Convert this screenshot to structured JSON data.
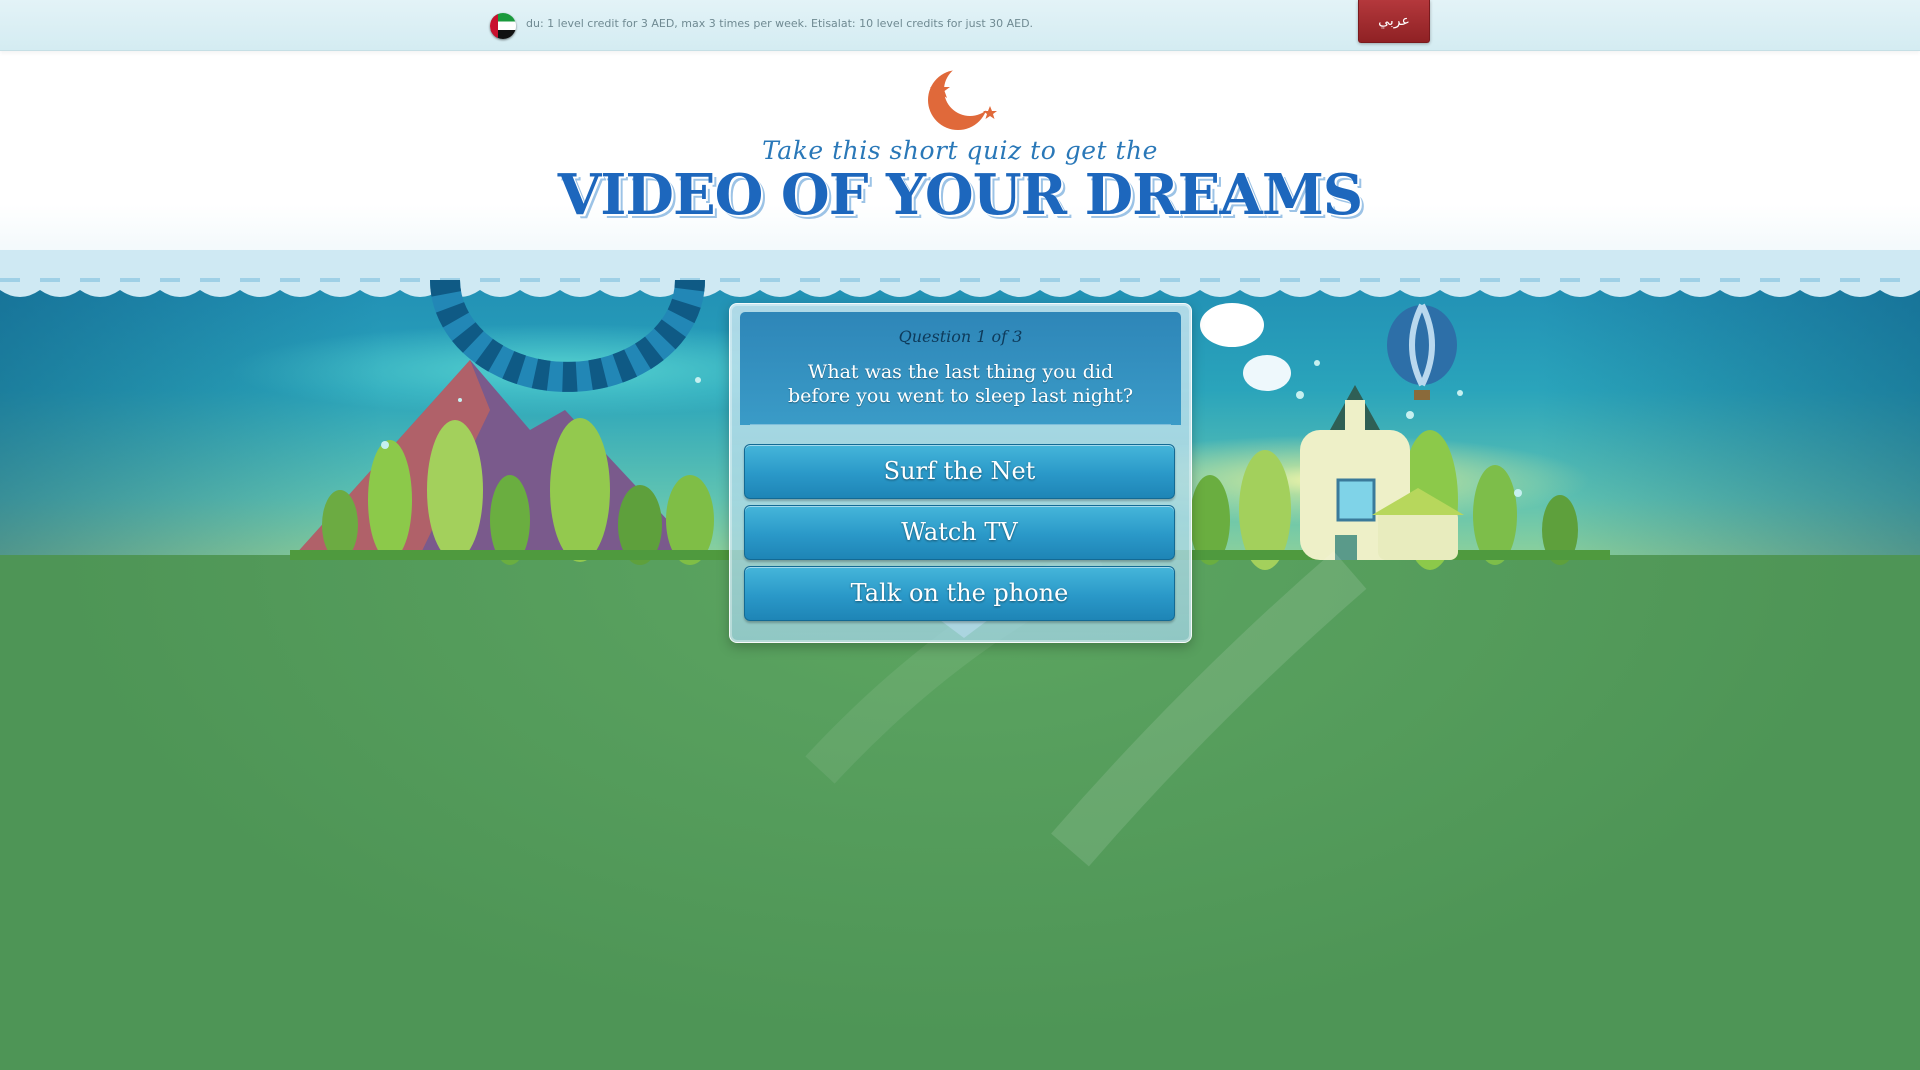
{
  "topbar": {
    "flag_icon": "uae-flag-icon",
    "pricing_text": "du: 1 level credit for 3 AED, max 3 times per week. Etisalat: 10 level credits for just 30 AED.",
    "language_button": "عربي"
  },
  "header": {
    "logo_icon": "moon-stars-icon",
    "subtitle": "Take this short quiz to get the",
    "title": "VIDEO OF YOUR DREAMS"
  },
  "quiz": {
    "question_number": "Question 1 of 3",
    "question_line1": "What was the last thing you did",
    "question_line2": "before you went to sleep last night?",
    "answers": [
      {
        "label": "Surf the Net"
      },
      {
        "label": "Watch TV"
      },
      {
        "label": "Talk on the phone"
      }
    ]
  },
  "colors": {
    "title_blue": "#1d67bd",
    "answer_button": "#2a98c8",
    "ground_green": "#569a5c",
    "language_red": "#a02a2e"
  }
}
